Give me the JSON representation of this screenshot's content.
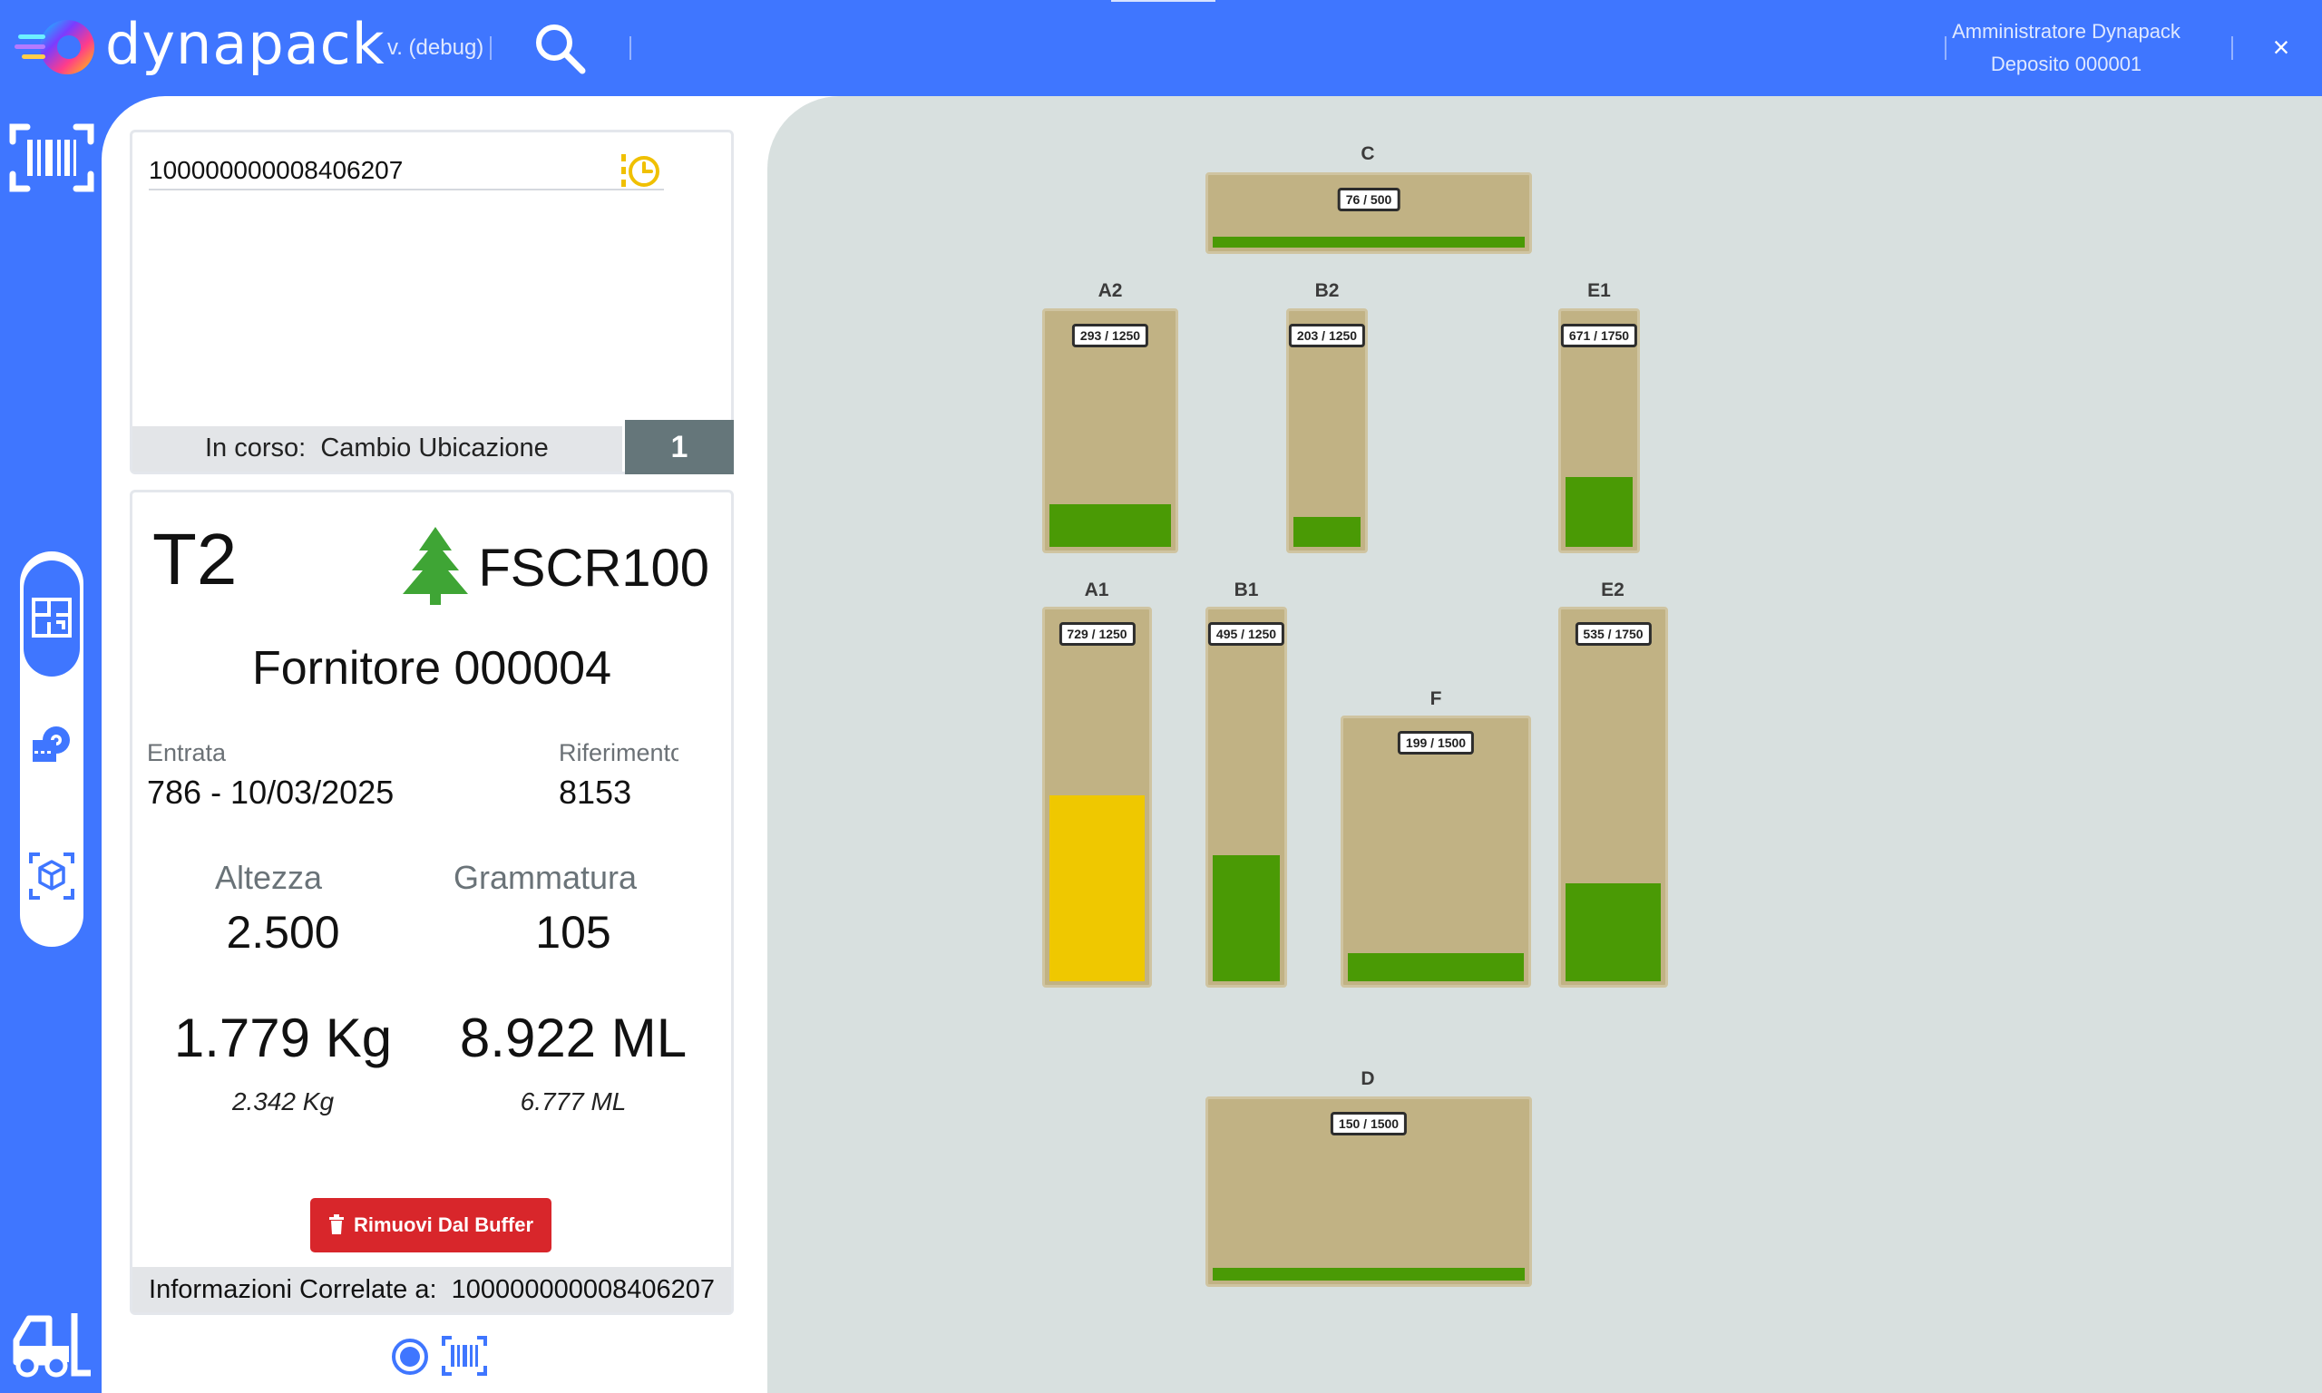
{
  "header": {
    "app_name": "dynapack",
    "version": "v. (debug)",
    "user": "Amministratore Dynapack",
    "depot": "Deposito 000001",
    "close": "×"
  },
  "scan": {
    "value": "100000000008406207",
    "status_prefix": "In corso:",
    "status_value": "Cambio Ubicazione",
    "count": "1"
  },
  "item": {
    "code": "T2",
    "article": "FSCR100",
    "supplier": "Fornitore 000004",
    "entry_label": "Entrata",
    "entry_value": "786 - 10/03/2025",
    "reference_label": "Riferimento",
    "reference_value": "8153",
    "height_label": "Altezza",
    "height_value": "2.500",
    "grammage_label": "Grammatura",
    "grammage_value": "105",
    "weight_value": "1.779 Kg",
    "weight_sub": "2.342 Kg",
    "length_value": "8.922 ML",
    "length_sub": "6.777 ML",
    "remove_label": "Rimuovi Dal Buffer",
    "related_prefix": "Informazioni Correlate a:",
    "related_value": "100000000008406207"
  },
  "colors": {
    "brand": "#3f76ff",
    "fill_ok": "#4a9a05",
    "fill_warn": "#efc800",
    "zone": "#c1b284",
    "danger": "#d8262b"
  },
  "zones": [
    {
      "id": "C",
      "badge": "76 / 500",
      "used": 76,
      "capacity": 500,
      "color": "#4a9a05"
    },
    {
      "id": "A2",
      "badge": "293 / 1250",
      "used": 293,
      "capacity": 1250,
      "color": "#4a9a05"
    },
    {
      "id": "B2",
      "badge": "203 / 1250",
      "used": 203,
      "capacity": 1250,
      "color": "#4a9a05"
    },
    {
      "id": "E1",
      "badge": "671 / 1750",
      "used": 671,
      "capacity": 1750,
      "color": "#4a9a05"
    },
    {
      "id": "A1",
      "badge": "729 / 1250",
      "used": 729,
      "capacity": 1250,
      "color": "#efc800"
    },
    {
      "id": "B1",
      "badge": "495 / 1250",
      "used": 495,
      "capacity": 1250,
      "color": "#4a9a05"
    },
    {
      "id": "F",
      "badge": "199 / 1500",
      "used": 199,
      "capacity": 1500,
      "color": "#4a9a05"
    },
    {
      "id": "E2",
      "badge": "535 / 1750",
      "used": 535,
      "capacity": 1750,
      "color": "#4a9a05"
    },
    {
      "id": "D",
      "badge": "150 / 1500",
      "used": 150,
      "capacity": 1500,
      "color": "#4a9a05"
    }
  ]
}
